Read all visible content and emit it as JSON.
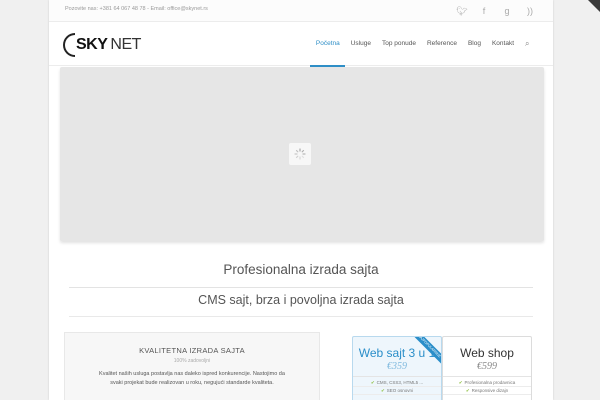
{
  "topbar": {
    "contact": "Pozovite nas: +381 64 067 48 78 - Email: office@skynet.rs",
    "social": [
      {
        "icon": "twitter-icon",
        "glyph": "🐦︎"
      },
      {
        "icon": "facebook-icon",
        "glyph": "f"
      },
      {
        "icon": "google-plus-icon",
        "glyph": "g"
      },
      {
        "icon": "rss-icon",
        "glyph": "))"
      }
    ]
  },
  "logo": {
    "part1": "SKY",
    "part2": "NET"
  },
  "nav": {
    "items": [
      "Početna",
      "Usluge",
      "Top ponude",
      "Reference",
      "Blog",
      "Kontakt"
    ],
    "active_index": 0,
    "search_icon": "search-icon"
  },
  "slider": {
    "loader_icon": "spinner-icon"
  },
  "main": {
    "title": "Profesionalna izrada sajta",
    "subtitle": "CMS sajt, brza i povoljna izrada sajta"
  },
  "quality": {
    "title": "KVALITETNA IZRADA SAJTA",
    "subtitle": "100% zadovoljni",
    "text": "Kvalitet naših usluga postavlja nas daleko ispred konkurencije. Nastojimo da svaki projekat bude realizovan u roku, negujući standarde kvaliteta."
  },
  "pricing": [
    {
      "title": "Web sajt 3 u 1",
      "price": "€359",
      "features": [
        "CMS, CSS3, HTML5 ...",
        "SEO osnovni"
      ],
      "ribbon": "NAJPOPULARNIJE"
    },
    {
      "title": "Web shop",
      "price": "€599",
      "features": [
        "Profesionalna prodavnica",
        "Responsive dizajn"
      ]
    }
  ],
  "colors": {
    "accent": "#2f8fc7",
    "background": "#f0f0f0",
    "slider": "#e6e6e6"
  }
}
